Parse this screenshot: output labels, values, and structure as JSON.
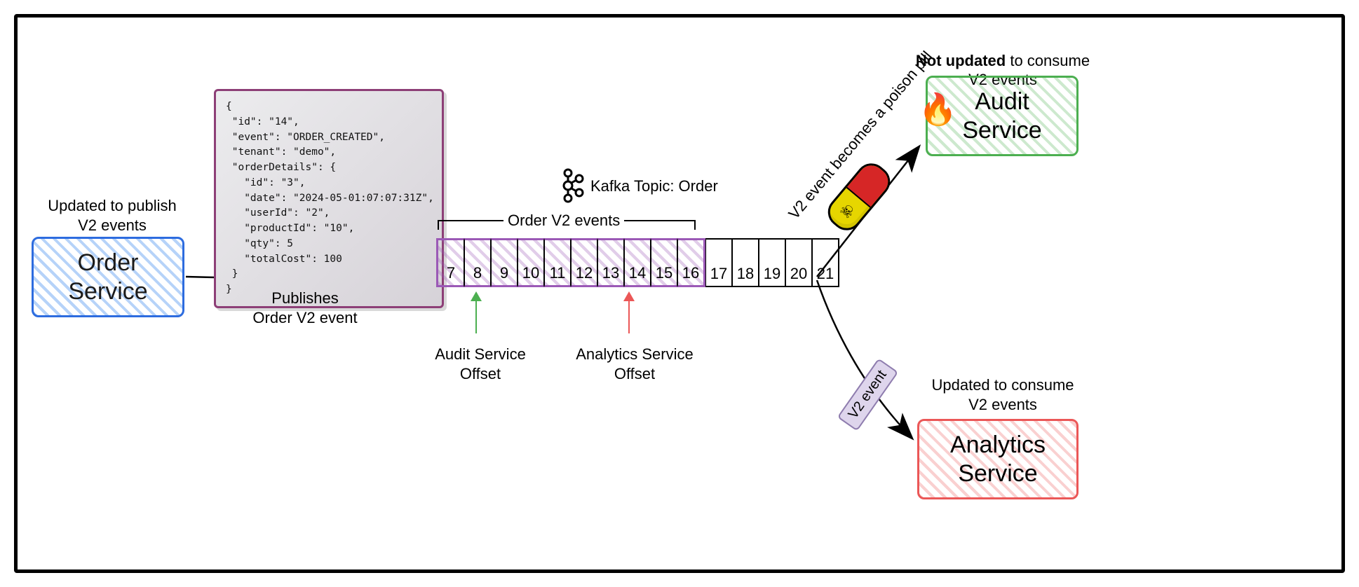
{
  "orderService": {
    "label": "Order\nService",
    "caption": "Updated to publish\nV2 events"
  },
  "publishArrowLabel": "Publishes\nOrder V2 event",
  "eventJson": "{\n \"id\": \"14\",\n \"event\": \"ORDER_CREATED\",\n \"tenant\": \"demo\",\n \"orderDetails\": {\n   \"id\": \"3\",\n   \"date\": \"2024-05-01:07:07:31Z\",\n   \"userId\": \"2\",\n   \"productId\": \"10\",\n   \"qty\": 5\n   \"totalCost\": 100\n }\n}",
  "topic": {
    "label": "Kafka Topic: Order",
    "v2GroupLabel": "Order V2 events",
    "cells": [
      {
        "offset": "7",
        "v2": true
      },
      {
        "offset": "8",
        "v2": true
      },
      {
        "offset": "9",
        "v2": true
      },
      {
        "offset": "10",
        "v2": true
      },
      {
        "offset": "11",
        "v2": true
      },
      {
        "offset": "12",
        "v2": true
      },
      {
        "offset": "13",
        "v2": true
      },
      {
        "offset": "14",
        "v2": true
      },
      {
        "offset": "15",
        "v2": true
      },
      {
        "offset": "16",
        "v2": true
      },
      {
        "offset": "17",
        "v2": false
      },
      {
        "offset": "18",
        "v2": false
      },
      {
        "offset": "19",
        "v2": false
      },
      {
        "offset": "20",
        "v2": false
      },
      {
        "offset": "21",
        "v2": false
      }
    ]
  },
  "offsets": {
    "audit": "Audit Service\nOffset",
    "analytics": "Analytics Service\nOffset"
  },
  "poisonPillLabel": "V2 event becomes\na poison pill",
  "v2EventTag": "V2 event",
  "auditService": {
    "label": "Audit\nService",
    "captionBold": "Not updated",
    "captionRest": " to consume\nV2 events"
  },
  "analyticsService": {
    "label": "Analytics\nService",
    "caption": "Updated to consume\nV2 events"
  }
}
